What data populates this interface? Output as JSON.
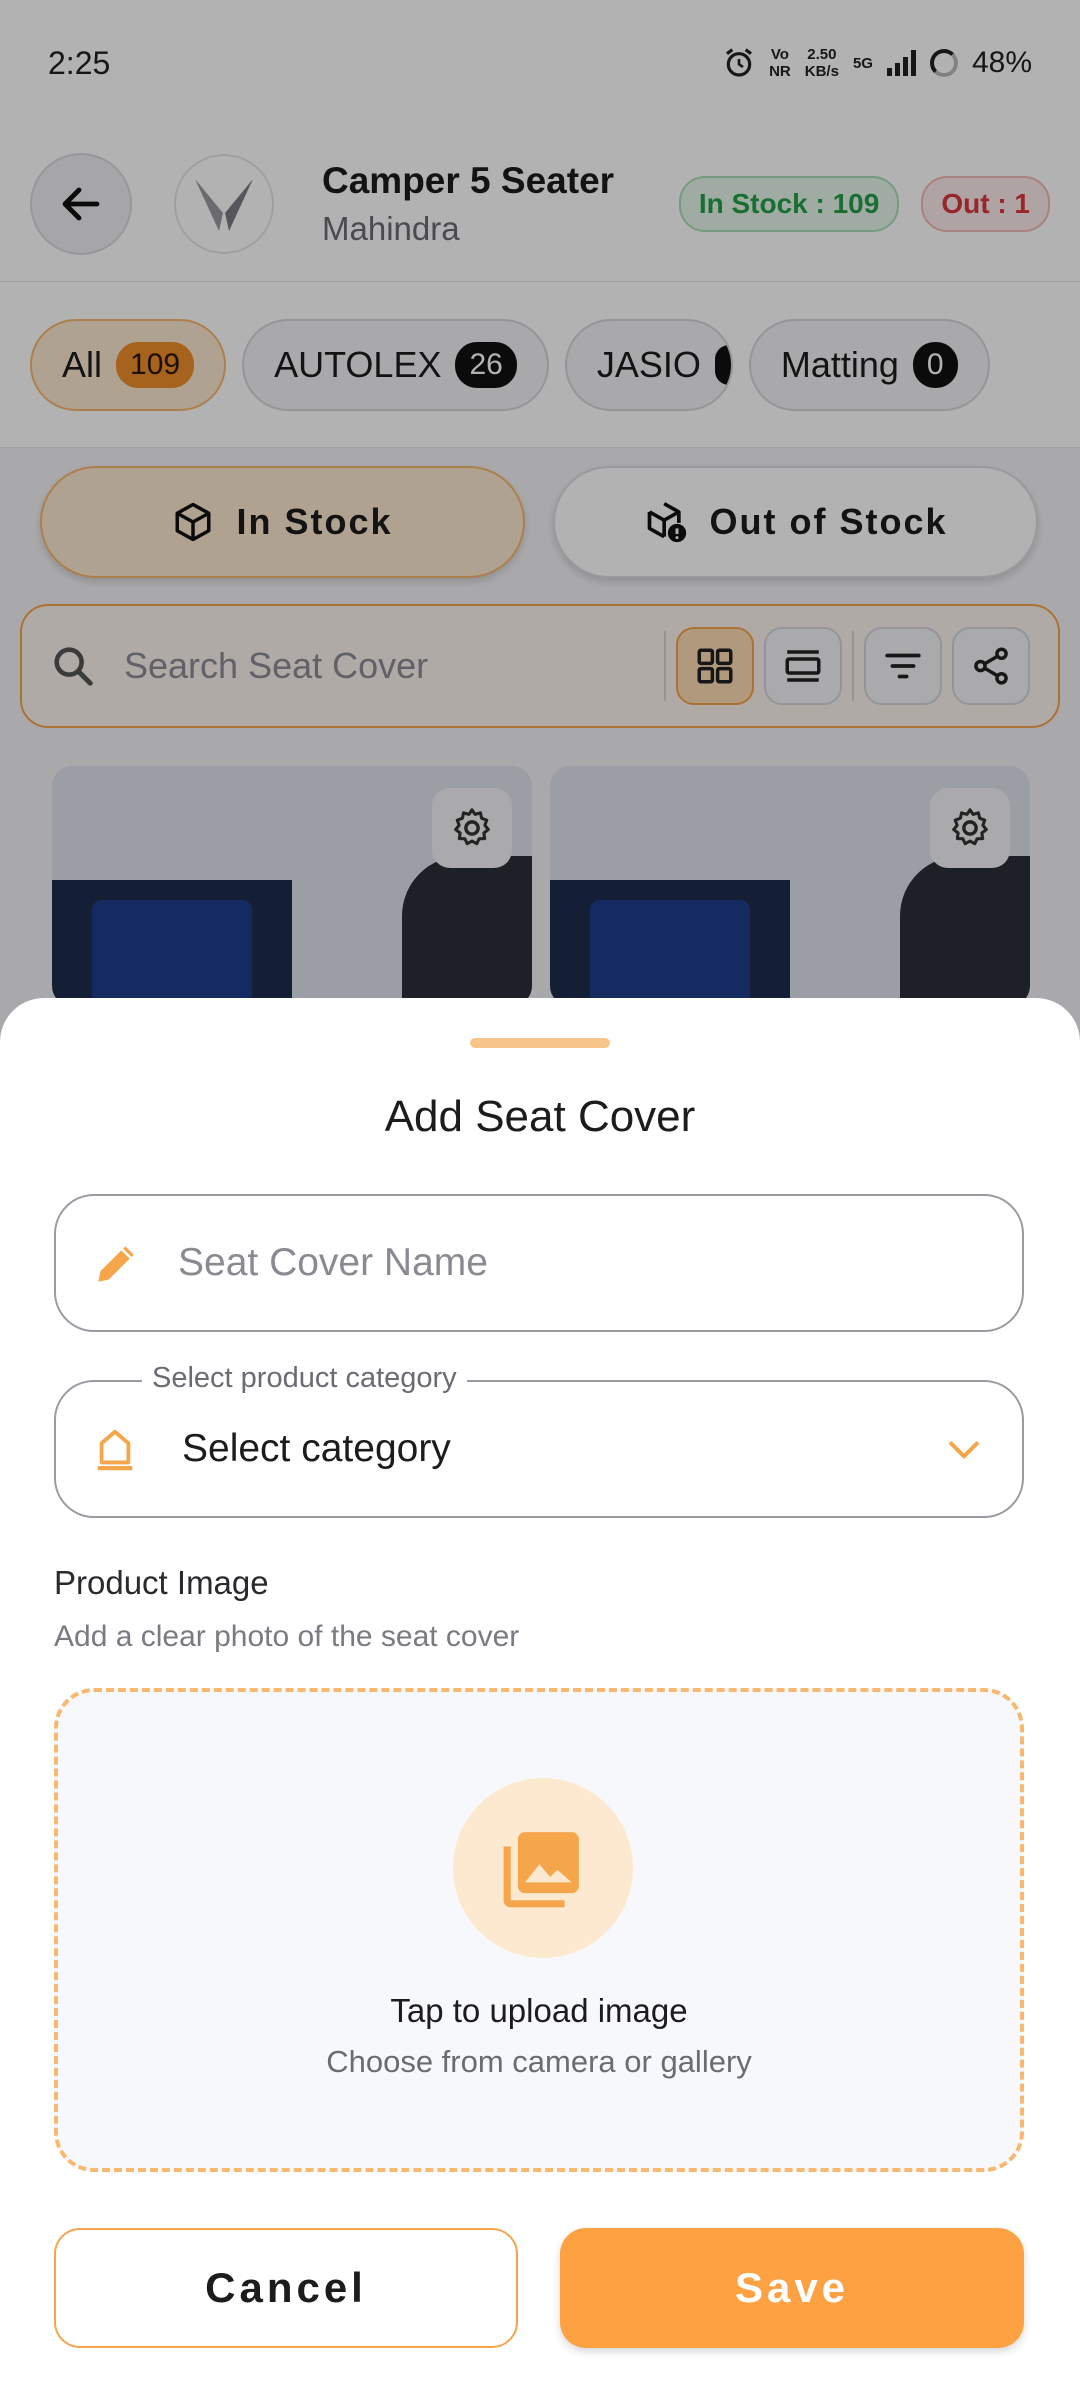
{
  "status_bar": {
    "time": "2:25",
    "vo": "Vo",
    "nr": "NR",
    "speed_value": "2.50",
    "speed_unit": "KB/s",
    "network": "5G",
    "battery": "48%"
  },
  "header": {
    "title": "Camper 5 Seater",
    "subtitle": "Mahindra",
    "in_stock_badge": "In Stock : 109",
    "out_badge": "Out : 1"
  },
  "brand_chips": [
    {
      "label": "All",
      "count": "109",
      "active": true
    },
    {
      "label": "AUTOLEX",
      "count": "26"
    },
    {
      "label": "JASIO",
      "count": ""
    },
    {
      "label": "Matting",
      "count": "0"
    }
  ],
  "stock_toggle": {
    "in_stock": "In Stock",
    "out_of_stock": "Out of Stock",
    "selected": "In Stock"
  },
  "search": {
    "placeholder": "Search Seat Cover"
  },
  "sheet": {
    "title": "Add Seat Cover",
    "name_field": {
      "placeholder": "Seat Cover Name",
      "value": ""
    },
    "category_field": {
      "label": "Select product category",
      "value": "Select category"
    },
    "image_section": {
      "title": "Product Image",
      "subtitle": "Add a clear photo of the seat cover"
    },
    "upload": {
      "title": "Tap to upload image",
      "subtitle": "Choose from camera or gallery"
    },
    "cancel_label": "Cancel",
    "save_label": "Save"
  },
  "colors": {
    "accent": "#fea142",
    "accent_light": "#fde9cf",
    "in_stock_green": "#25a049",
    "out_red": "#d9363e"
  }
}
